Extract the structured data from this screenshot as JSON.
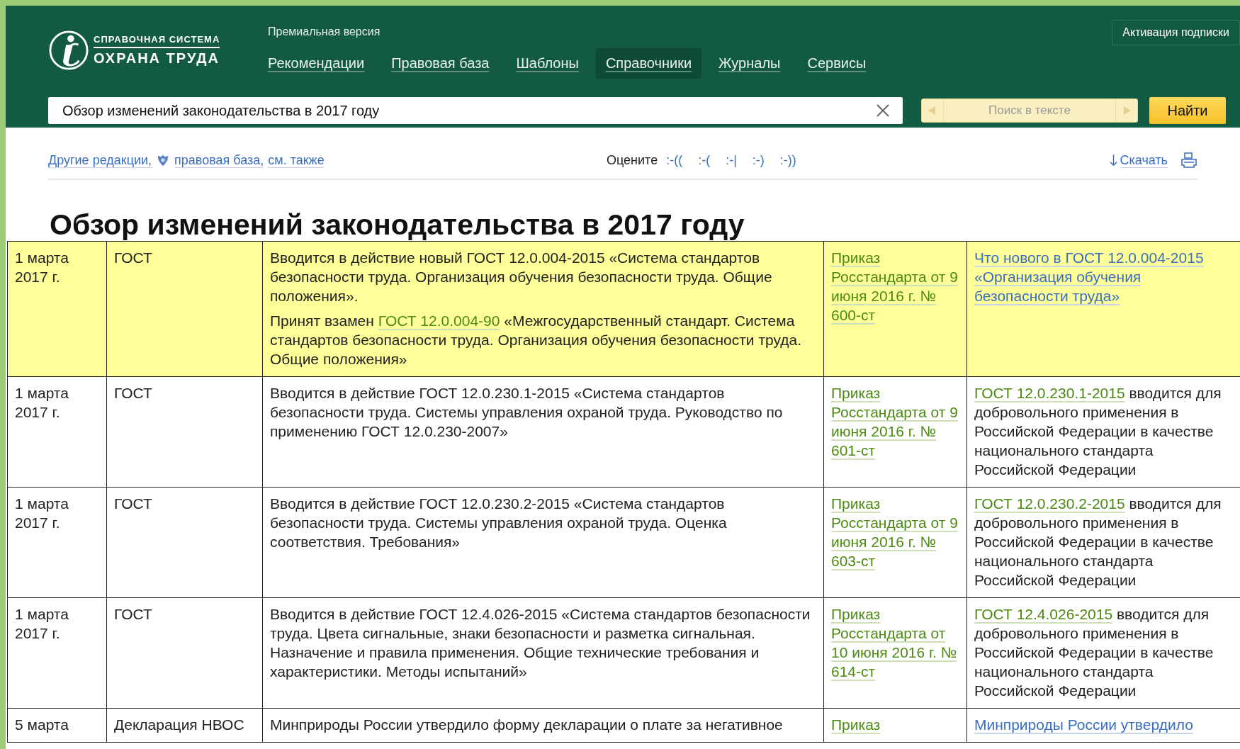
{
  "header": {
    "logo": {
      "top": "СПРАВОЧНАЯ СИСТЕМА",
      "bottom": "ОХРАНА ТРУДА"
    },
    "edition": "Премиальная версия",
    "activation": "Активация подписки",
    "nav": [
      {
        "label": "Рекомендации",
        "selected": false
      },
      {
        "label": "Правовая база",
        "selected": false
      },
      {
        "label": "Шаблоны",
        "selected": false
      },
      {
        "label": "Справочники",
        "selected": true
      },
      {
        "label": "Журналы",
        "selected": false
      },
      {
        "label": "Сервисы",
        "selected": false
      }
    ],
    "search": {
      "value": "Обзор изменений законодательства в 2017 году",
      "text_search_placeholder": "Поиск в тексте",
      "button": "Найти"
    }
  },
  "toolbar": {
    "links": [
      {
        "label": "Другие редакции,",
        "kind": "plain"
      },
      {
        "label": "правовая база,",
        "kind": "emblem"
      },
      {
        "label": "см. также",
        "kind": "plain"
      }
    ],
    "rate_label": "Оцените",
    "rates": [
      ":-((",
      ":-(",
      ":-|",
      ":-)",
      ":-))"
    ],
    "download": "Скачать"
  },
  "title": "Обзор изменений законодательства в 2017 году",
  "table": {
    "rows": [
      {
        "highlighted": true,
        "date": "1 марта 2017 г.",
        "type": "ГОСТ",
        "description": [
          [
            {
              "text": "Вводится в действие новый ГОСТ 12.0.004-2015 «Система стандартов безопасности труда. Организация обучения безопасности труда. Общие положения».",
              "kind": "text"
            }
          ],
          [
            {
              "text": "Принят взамен ",
              "kind": "text"
            },
            {
              "text": "ГОСТ 12.0.004-90",
              "kind": "doc_link"
            },
            {
              "text": " «Межгосударственный стандарт. Система стандартов безопасности труда. Организация обучения безопасности труда. Общие положения»",
              "kind": "text"
            }
          ]
        ],
        "document": "Приказ Росстандарта от 9 июня 2016 г. № 600-ст",
        "comment": [
          {
            "text": "Что нового в ГОСТ 12.0.004-2015 «Организация обучения безопасности труда»",
            "kind": "article_link"
          }
        ]
      },
      {
        "highlighted": false,
        "date": "1 марта 2017 г.",
        "type": "ГОСТ",
        "description": [
          [
            {
              "text": "Вводится в действие ГОСТ 12.0.230.1-2015 «Система стандартов безопасности труда. Системы управления охраной труда. Руководство по применению ГОСТ 12.0.230-2007»",
              "kind": "text"
            }
          ]
        ],
        "document": "Приказ Росстандарта от 9 июня 2016 г. № 601-ст",
        "comment": [
          {
            "text": "ГОСТ 12.0.230.1-2015",
            "kind": "doc_link"
          },
          {
            "text": " вводится для добровольного применения в Российской Федерации в качестве национального стандарта Российской Федерации",
            "kind": "text"
          }
        ]
      },
      {
        "highlighted": false,
        "date": "1 марта 2017 г.",
        "type": "ГОСТ",
        "description": [
          [
            {
              "text": "Вводится в действие ГОСТ 12.0.230.2-2015 «Система стандартов безопасности труда. Системы управления охраной труда. Оценка соответствия. Требования»",
              "kind": "text"
            }
          ]
        ],
        "document": "Приказ Росстандарта от 9 июня 2016 г. № 603-ст",
        "comment": [
          {
            "text": "ГОСТ 12.0.230.2-2015",
            "kind": "doc_link"
          },
          {
            "text": " вводится для добровольного применения в Российской Федерации в качестве национального стандарта Российской Федерации",
            "kind": "text"
          }
        ]
      },
      {
        "highlighted": false,
        "date": "1 марта 2017 г.",
        "type": "ГОСТ",
        "description": [
          [
            {
              "text": "Вводится в действие ГОСТ 12.4.026-2015 «Система стандартов безопасности труда. Цвета сигнальные, знаки безопасности и разметка сигнальная. Назначение и правила применения. Общие технические требования и характеристики. Методы испытаний»",
              "kind": "text"
            }
          ]
        ],
        "document": "Приказ Росстандарта от 10 июня 2016 г. № 614-ст",
        "comment": [
          {
            "text": "ГОСТ 12.4.026-2015",
            "kind": "doc_link"
          },
          {
            "text": " вводится для добровольного применения в Российской Федерации в качестве национального стандарта Российской Федерации",
            "kind": "text"
          }
        ]
      },
      {
        "highlighted": false,
        "date": "5 марта",
        "type": "Декларация НВОС",
        "description": [
          [
            {
              "text": "Минприроды России утвердило форму декларации о плате за негативное",
              "kind": "text"
            }
          ]
        ],
        "document": "Приказ",
        "comment": [
          {
            "text": "Минприроды России утвердило",
            "kind": "article_link"
          }
        ]
      }
    ]
  }
}
